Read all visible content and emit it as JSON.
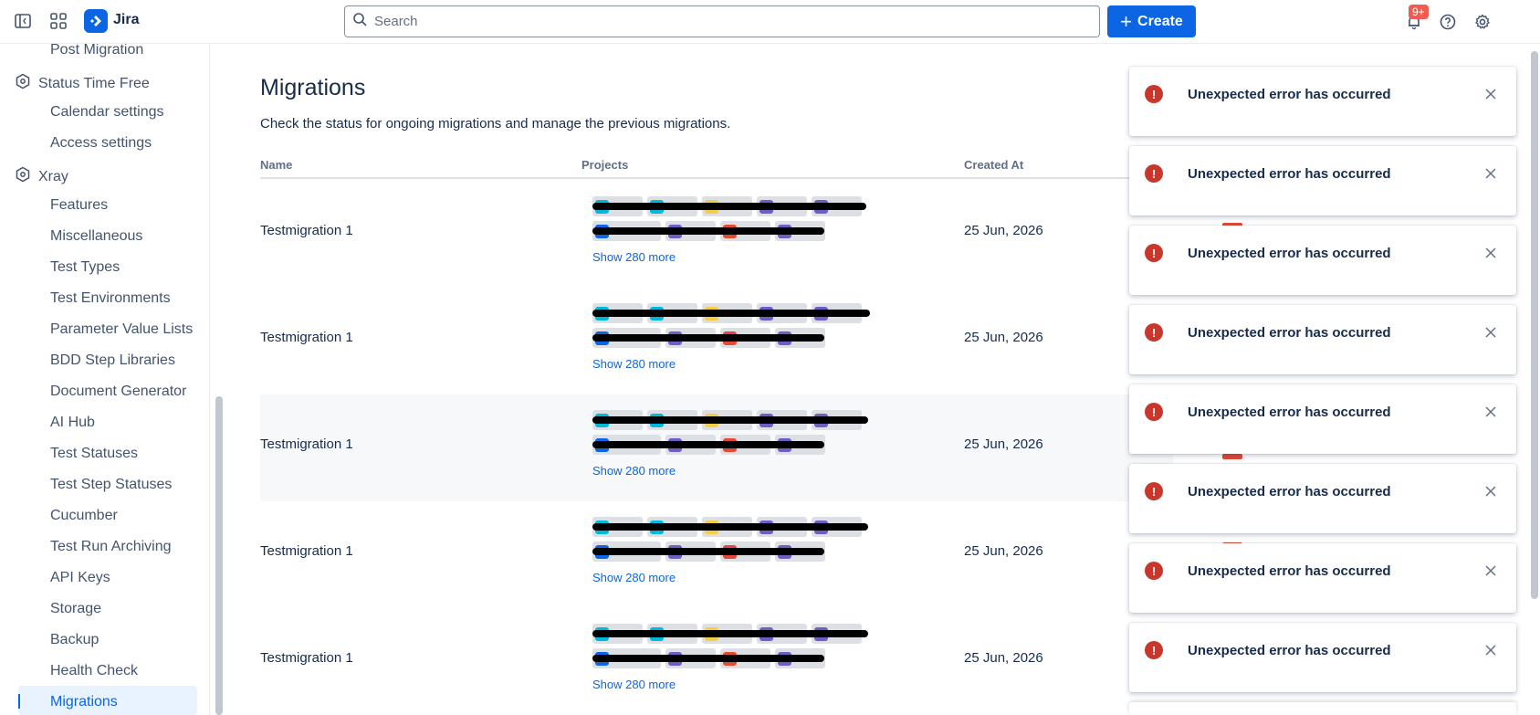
{
  "app": {
    "name": "Jira",
    "notifications_badge": "9+",
    "accent": "#0c66e4"
  },
  "search": {
    "placeholder": "Search"
  },
  "create": {
    "label": "Create"
  },
  "sidebar": {
    "items": [
      {
        "label": "Post Migration",
        "type": "item"
      },
      {
        "label": "Status Time Free",
        "type": "group"
      },
      {
        "label": "Calendar settings",
        "type": "item"
      },
      {
        "label": "Access settings",
        "type": "item"
      },
      {
        "label": "Xray",
        "type": "group"
      },
      {
        "label": "Features",
        "type": "item"
      },
      {
        "label": "Miscellaneous",
        "type": "item"
      },
      {
        "label": "Test Types",
        "type": "item"
      },
      {
        "label": "Test Environments",
        "type": "item"
      },
      {
        "label": "Parameter Value Lists",
        "type": "item"
      },
      {
        "label": "BDD Step Libraries",
        "type": "item"
      },
      {
        "label": "Document Generator",
        "type": "item"
      },
      {
        "label": "AI Hub",
        "type": "item"
      },
      {
        "label": "Test Statuses",
        "type": "item"
      },
      {
        "label": "Test Step Statuses",
        "type": "item"
      },
      {
        "label": "Cucumber",
        "type": "item"
      },
      {
        "label": "Test Run Archiving",
        "type": "item"
      },
      {
        "label": "API Keys",
        "type": "item"
      },
      {
        "label": "Storage",
        "type": "item"
      },
      {
        "label": "Backup",
        "type": "item"
      },
      {
        "label": "Health Check",
        "type": "item"
      },
      {
        "label": "Migrations",
        "type": "item",
        "active": true
      }
    ]
  },
  "page": {
    "title": "Migrations",
    "description": "Check the status for ongoing migrations and manage the previous migrations."
  },
  "table": {
    "headers": [
      "Name",
      "Projects",
      "Created At"
    ],
    "rows": [
      {
        "name": "Testmigration 1",
        "show_more": "Show 280 more",
        "created_at": "25 Jun, 2026"
      },
      {
        "name": "Testmigration 1",
        "show_more": "Show 280 more",
        "created_at": "25 Jun, 2026"
      },
      {
        "name": "Testmigration 1",
        "show_more": "Show 280 more",
        "created_at": "25 Jun, 2026"
      },
      {
        "name": "Testmigration 1",
        "show_more": "Show 280 more",
        "created_at": "25 Jun, 2026"
      },
      {
        "name": "Testmigration 1",
        "show_more": "Show 280 more",
        "created_at": "25 Jun, 2026"
      }
    ]
  },
  "toasts": [
    {
      "message": "Unexpected error has occurred"
    },
    {
      "message": "Unexpected error has occurred"
    },
    {
      "message": "Unexpected error has occurred"
    },
    {
      "message": "Unexpected error has occurred"
    },
    {
      "message": "Unexpected error has occurred"
    },
    {
      "message": "Unexpected error has occurred"
    },
    {
      "message": "Unexpected error has occurred"
    },
    {
      "message": "Unexpected error has occurred"
    }
  ],
  "colors": {
    "error": "#c9372c",
    "chip_teal": "#1d9aaa",
    "chip_cyan": "#00b8d9",
    "chip_yellow": "#f5cd47",
    "chip_purple": "#6e5dc6",
    "chip_red": "#e34935",
    "chip_blue": "#0c66e4"
  }
}
